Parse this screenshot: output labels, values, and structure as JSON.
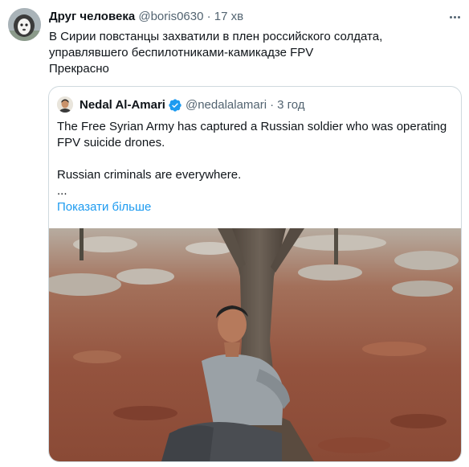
{
  "tweet": {
    "author_name": "Друг человека",
    "author_handle": "@boris0630",
    "separator": "·",
    "time": "17 хв",
    "text_lines": [
      "В Сирии повстанцы захватили в плен российского солдата,",
      "управлявшего беспилотниками-камикадзе FPV",
      "Прекрасно"
    ]
  },
  "quote": {
    "author_name": "Nedal Al-Amari",
    "author_handle": "@nedalalamari",
    "separator": "·",
    "time": "3 год",
    "text_lines": [
      "The Free Syrian Army has captured a Russian soldier who was operating",
      "FPV suicide drones.",
      "",
      "Russian criminals are everywhere.",
      "..."
    ],
    "show_more": "Показати більше",
    "media_kind": "video-still"
  },
  "icons": {
    "menu": "more-horizontal-icon",
    "verified": "verified-badge-icon"
  },
  "colors": {
    "link": "#1d9bf0",
    "secondary_text": "#536471",
    "border": "#cfd9de"
  }
}
